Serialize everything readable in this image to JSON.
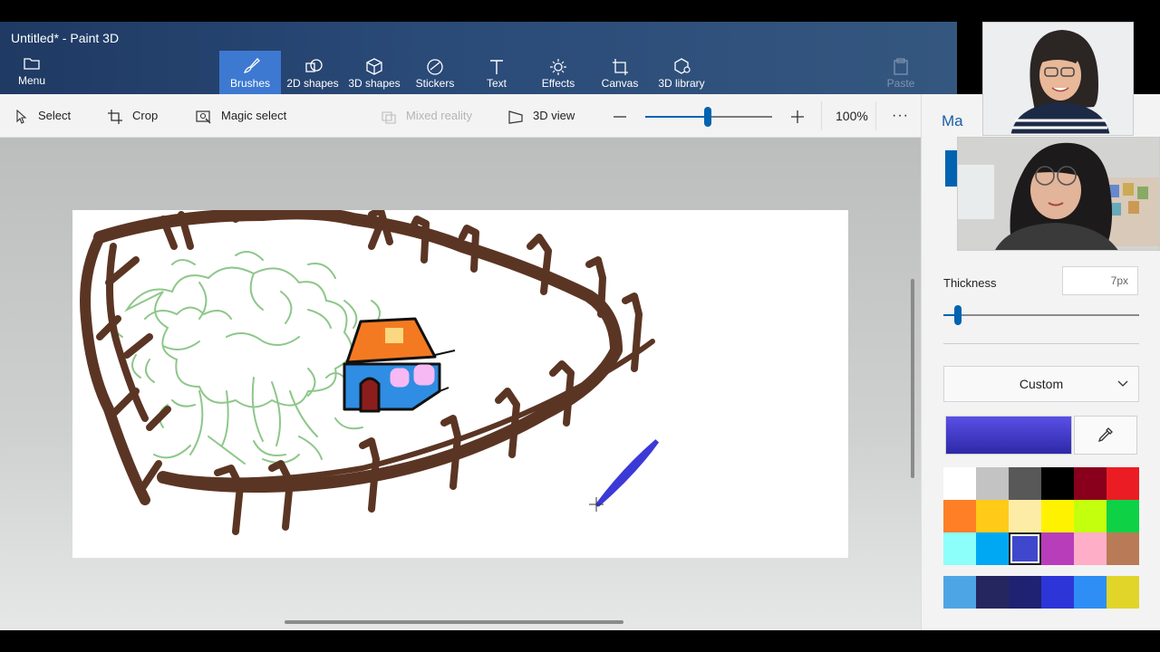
{
  "window": {
    "title": "Untitled* - Paint 3D"
  },
  "ribbon": {
    "menu_label": "Menu",
    "tabs": [
      {
        "label": "Brushes",
        "icon": "brush-icon",
        "active": true
      },
      {
        "label": "2D shapes",
        "icon": "2d-shapes-icon",
        "active": false
      },
      {
        "label": "3D shapes",
        "icon": "3d-cube-icon",
        "active": false
      },
      {
        "label": "Stickers",
        "icon": "sticker-icon",
        "active": false
      },
      {
        "label": "Text",
        "icon": "text-icon",
        "active": false
      },
      {
        "label": "Effects",
        "icon": "effects-sun-icon",
        "active": false
      },
      {
        "label": "Canvas",
        "icon": "canvas-crop-icon",
        "active": false
      },
      {
        "label": "3D library",
        "icon": "3d-library-icon",
        "active": false
      }
    ],
    "paste_label": "Paste"
  },
  "toolbar": {
    "select_label": "Select",
    "crop_label": "Crop",
    "magic_select_label": "Magic select",
    "mixed_reality_label": "Mixed reality",
    "view3d_label": "3D view",
    "zoom_value": "100%",
    "zoom_level_fraction": 0.5,
    "more_label": "···"
  },
  "panel": {
    "title_partial": "Ma",
    "thickness_label": "Thickness",
    "thickness_value": "7px",
    "thickness_fraction": 0.07,
    "color_mode": "Custom",
    "current_color": "#3f3ad0",
    "palette": [
      "#ffffff",
      "#c3c3c3",
      "#585858",
      "#000000",
      "#88001b",
      "#ec1c24",
      "#ff7f27",
      "#ffca18",
      "#fdeca6",
      "#fff200",
      "#c4ff0e",
      "#0ed145",
      "#8cfffb",
      "#00a8f3",
      "#3f48cc",
      "#b83dba",
      "#ffaec8",
      "#b97a57"
    ],
    "selected_swatch_index": 14,
    "custom_palette": [
      "#4ea5e6",
      "#25265f",
      "#1f2270",
      "#2d35d8",
      "#2e8ef5",
      "#e1d52a"
    ]
  },
  "video": {
    "participant1": "participant-1-video",
    "participant2": "participant-2-video"
  }
}
